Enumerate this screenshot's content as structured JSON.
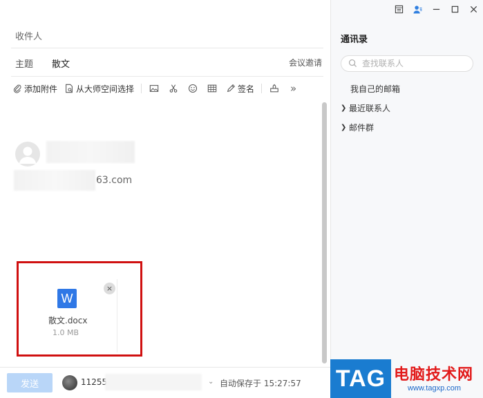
{
  "compose": {
    "to_label": "收件人",
    "subject_label": "主题",
    "subject_value": "散文",
    "meeting_invite": "会议邀请",
    "toolbar": {
      "add_attachment": "添加附件",
      "from_master_space": "从大师空间选择",
      "signature": "签名",
      "more": "»"
    },
    "recipient_email_tail": "63.com",
    "attachment": {
      "icon_letter": "W",
      "file_name": "散文.docx",
      "file_size": "1.0 MB",
      "close": "×"
    },
    "footer": {
      "send": "发送",
      "sender_id": "11255",
      "autosave": "自动保存于 15:27:57"
    }
  },
  "contacts": {
    "title": "通讯录",
    "search_placeholder": "查找联系人",
    "items": [
      {
        "label": "我自己的邮箱",
        "expandable": false
      },
      {
        "label": "最近联系人",
        "expandable": true
      },
      {
        "label": "邮件群",
        "expandable": true
      }
    ]
  },
  "watermark": {
    "tag": "TAG",
    "cn": "电脑技术网",
    "url": "www.tagxp.com"
  },
  "colors": {
    "accent_blue": "#2f78e6",
    "send_disabled": "#b9d6f8",
    "highlight_red": "#d01010"
  }
}
